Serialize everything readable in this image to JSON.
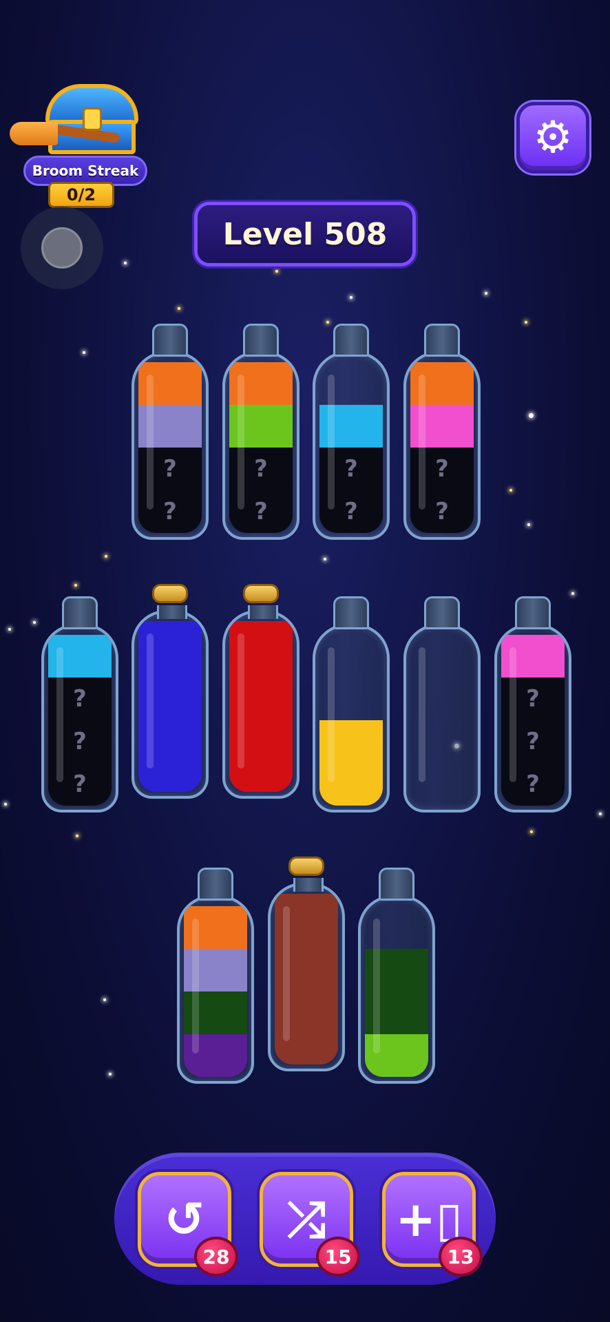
{
  "broom_streak": {
    "label": "Broom Streak",
    "progress": "0/2"
  },
  "level": {
    "label": "Level 508"
  },
  "settings": {
    "icon": "gear-icon"
  },
  "colors": {
    "orange": "#f0701c",
    "lavender": "#8a83c9",
    "lime": "#6bc51d",
    "cyan": "#22b4ea",
    "pink": "#f24fce",
    "blue": "#2b22d8",
    "red": "#d40f14",
    "yellow": "#f7c31a",
    "dark_green": "#154a12",
    "purple": "#5a1e95",
    "brown": "#8a3528",
    "hidden": "#0a0a14"
  },
  "bottles": [
    {
      "id": 1,
      "corked": false,
      "layers": [
        "hidden",
        "hidden",
        "lavender",
        "orange"
      ]
    },
    {
      "id": 2,
      "corked": false,
      "layers": [
        "hidden",
        "hidden",
        "lime",
        "orange"
      ]
    },
    {
      "id": 3,
      "corked": false,
      "layers": [
        "hidden",
        "hidden",
        "cyan"
      ]
    },
    {
      "id": 4,
      "corked": false,
      "layers": [
        "hidden",
        "hidden",
        "pink",
        "orange"
      ]
    },
    {
      "id": 5,
      "corked": false,
      "layers": [
        "hidden",
        "hidden",
        "hidden",
        "cyan"
      ]
    },
    {
      "id": 6,
      "corked": true,
      "layers": [
        "blue",
        "blue",
        "blue",
        "blue"
      ]
    },
    {
      "id": 7,
      "corked": true,
      "layers": [
        "red",
        "red",
        "red",
        "red"
      ]
    },
    {
      "id": 8,
      "corked": false,
      "layers": [
        "yellow",
        "yellow"
      ]
    },
    {
      "id": 9,
      "corked": false,
      "layers": []
    },
    {
      "id": 10,
      "corked": false,
      "layers": [
        "hidden",
        "hidden",
        "hidden",
        "pink"
      ]
    },
    {
      "id": 11,
      "corked": false,
      "layers": [
        "purple",
        "dark_green",
        "lavender",
        "orange"
      ]
    },
    {
      "id": 12,
      "corked": true,
      "layers": [
        "brown",
        "brown",
        "brown",
        "brown"
      ]
    },
    {
      "id": 13,
      "corked": false,
      "layers": [
        "lime",
        "dark_green",
        "dark_green"
      ]
    }
  ],
  "hidden_mark": "?",
  "tools": [
    {
      "name": "undo",
      "icon": "undo-icon",
      "glyph": "↺",
      "count": "28"
    },
    {
      "name": "shuffle",
      "icon": "shuffle-icon",
      "glyph": "⤮",
      "count": "15"
    },
    {
      "name": "add-bottle",
      "icon": "add-bottle-icon",
      "glyph": "+▯",
      "count": "13"
    }
  ]
}
